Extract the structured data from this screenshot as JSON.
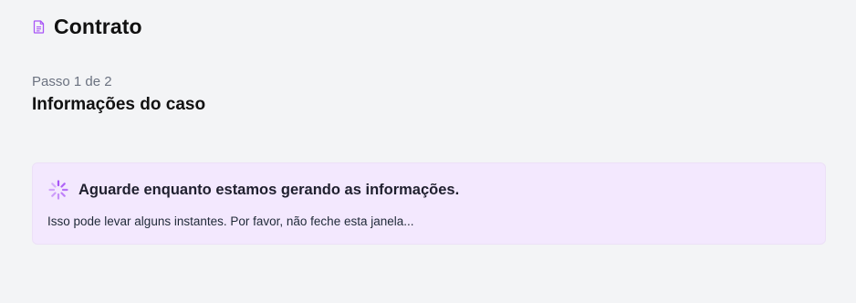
{
  "header": {
    "icon": "document-icon",
    "title": "Contrato"
  },
  "step": {
    "counter": "Passo 1 de 2",
    "title": "Informações do caso"
  },
  "alert": {
    "icon": "spinner-icon",
    "title": "Aguarde enquanto estamos gerando as informações.",
    "message": "Isso pode levar alguns instantes. Por favor, não feche esta janela..."
  },
  "colors": {
    "accent": "#a855f7",
    "alert_background": "#f3e8fe",
    "page_background": "#f3f4f6"
  }
}
